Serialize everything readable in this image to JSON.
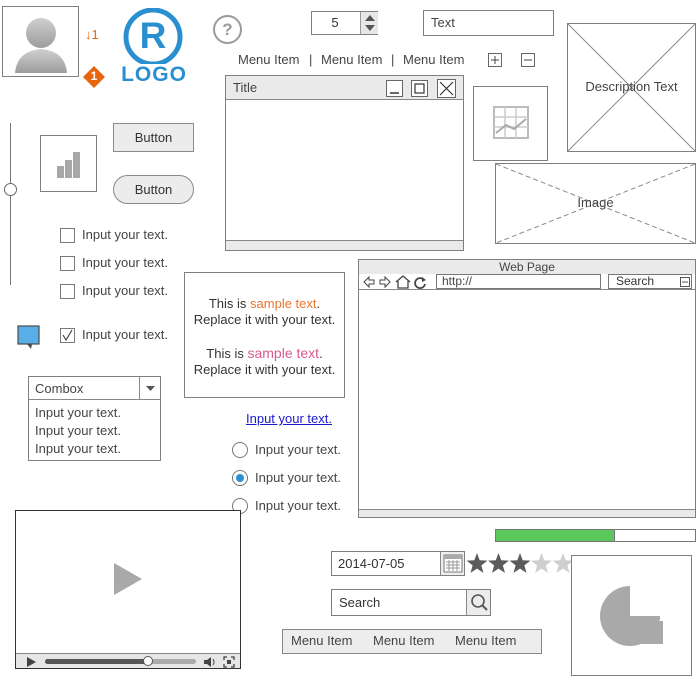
{
  "avatar": {
    "arrow_count": "1",
    "badge_count": "1"
  },
  "logo": {
    "mark": "R",
    "text": "LOGO"
  },
  "help": {
    "icon": "question-icon",
    "glyph": "?"
  },
  "stepper": {
    "value": "5"
  },
  "text_field": {
    "value": "Text"
  },
  "top_menu": {
    "items": [
      "Menu Item",
      "Menu Item",
      "Menu Item"
    ],
    "separator": "|"
  },
  "window": {
    "title": "Title"
  },
  "description_box": {
    "text": "Description Text"
  },
  "image_box": {
    "text": "Image"
  },
  "buttons": {
    "square_label": "Button",
    "rounded_label": "Button"
  },
  "checkboxes": [
    {
      "label": "Input your text.",
      "checked": false
    },
    {
      "label": "Input your text.",
      "checked": false
    },
    {
      "label": "Input your text.",
      "checked": false
    },
    {
      "label": "Input your text.",
      "checked": true
    }
  ],
  "sample_text": {
    "line1_prefix": "This is ",
    "line1_highlight": "sample text",
    "line1_suffix": ".",
    "line2": "Replace it with your text.",
    "line3_prefix": "This is ",
    "line3_highlight": "sample text",
    "line3_suffix": ".",
    "line4": "Replace it with your text.",
    "color1": "#e8762c",
    "color2": "#d9588f"
  },
  "link": {
    "text": "Input your text."
  },
  "combobox": {
    "selected": "Combox",
    "options": [
      "Input your text.",
      "Input your text.",
      "Input your text."
    ]
  },
  "radios": [
    {
      "label": "Input your text.",
      "selected": false
    },
    {
      "label": "Input your text.",
      "selected": true
    },
    {
      "label": "Input your text.",
      "selected": false
    }
  ],
  "browser": {
    "title": "Web Page",
    "url": "http://",
    "search": "Search"
  },
  "progress": {
    "value": 0.6,
    "color": "#5ac85a"
  },
  "date_field": {
    "value": "2014-07-05"
  },
  "rating": {
    "value": 3,
    "max": 5
  },
  "search_field": {
    "placeholder": "Search"
  },
  "bottom_menu": {
    "items": [
      "Menu Item",
      "Menu Item",
      "Menu Item"
    ]
  },
  "video": {
    "position": 0.68
  },
  "colors": {
    "accent": "#2a8fd0",
    "logo_blue": "#2a8fd0",
    "badge": "#e8650f"
  }
}
